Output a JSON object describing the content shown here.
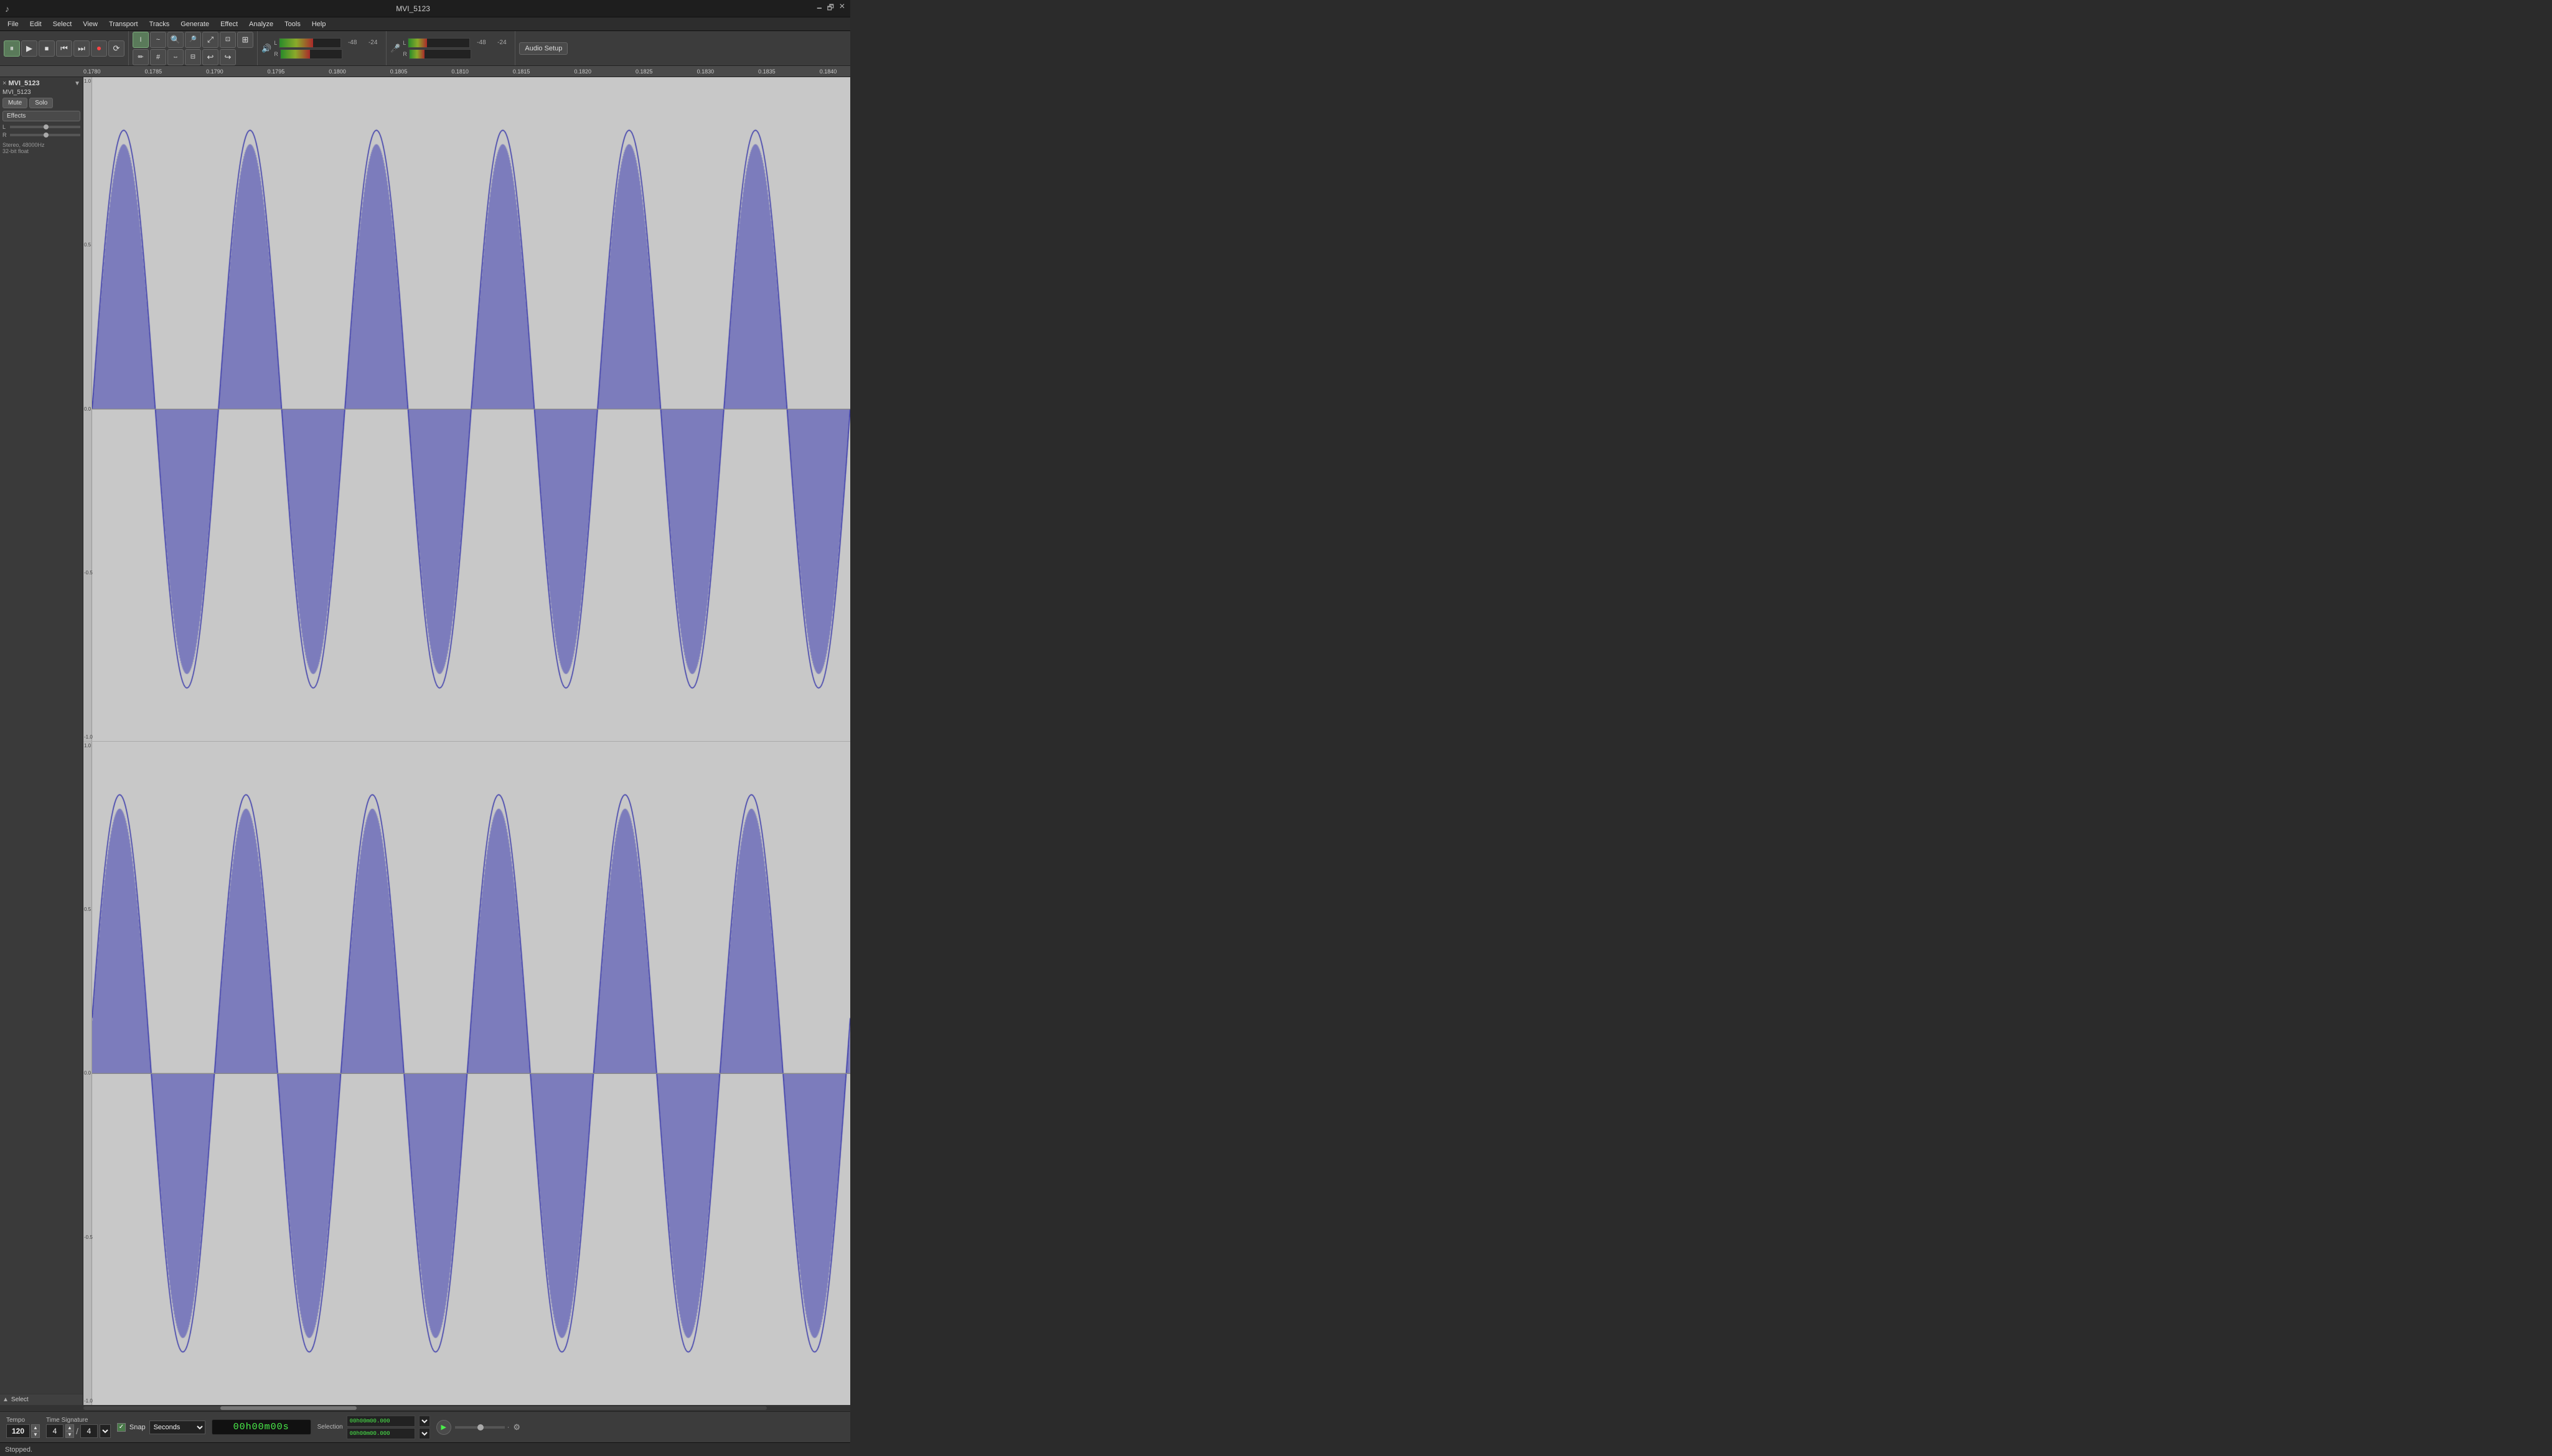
{
  "titlebar": {
    "logo": "♪",
    "title": "MVI_5123",
    "minimize": "🗕",
    "restore": "🗗",
    "close": "✕"
  },
  "menubar": {
    "items": [
      "File",
      "Edit",
      "Select",
      "View",
      "Transport",
      "Tracks",
      "Generate",
      "Effect",
      "Analyze",
      "Tools",
      "Help"
    ]
  },
  "toolbar": {
    "transport": {
      "pause_label": "⏸",
      "play_label": "▶",
      "stop_label": "⏹",
      "prev_label": "⏮",
      "next_label": "⏭",
      "record_label": "⏺",
      "loop_label": "⟳"
    },
    "tools": {
      "cursor_label": "I",
      "envelope_label": "~",
      "zoom_in_label": "+",
      "zoom_out_label": "−",
      "zoom_fit_label": "⤢",
      "zoom_sel_label": "⊡",
      "draw_label": "✏",
      "multi_label": "#",
      "time_shift": "⇔",
      "undo_label": "↩",
      "redo_label": "↪"
    },
    "audio_setup_label": "Audio Setup",
    "output_label": "-48",
    "output_label2": "-24",
    "input_label": "-48",
    "input_label2": "-24",
    "lr_output": "L R",
    "lr_input": "L R"
  },
  "ruler": {
    "ticks": [
      "0.1780",
      "0.1785",
      "0.1790",
      "0.1795",
      "0.1800",
      "0.1805",
      "0.1810",
      "0.1815",
      "0.1820",
      "0.1825",
      "0.1830",
      "0.1835",
      "0.1840"
    ]
  },
  "track": {
    "name": "MVI_5123",
    "close_label": "×",
    "arrow_label": "▼",
    "mute_label": "Mute",
    "solo_label": "Solo",
    "effects_label": "Effects",
    "header_name": "MVI_5123",
    "info_line1": "Stereo, 48000Hz",
    "info_line2": "32-bit float",
    "gain_label": "L",
    "scale_top": "1.0",
    "scale_mid_upper": "0.5",
    "scale_center": "0.0",
    "scale_mid_lower": "-0.5",
    "scale_bottom": "-1.0",
    "scale_top2": "1.0",
    "scale_mid_upper2": "0.5",
    "scale_center2": "0.0",
    "scale_mid_lower2": "-0.5",
    "scale_bottom2": "-1.0"
  },
  "bottom": {
    "tempo_label": "Tempo",
    "tempo_value": "120",
    "time_sig_label": "Time Signature",
    "time_sig_num": "4",
    "time_sig_denom": "4",
    "snap_label": "Snap",
    "snap_checked": true,
    "snap_unit": "Seconds",
    "time_display": "0 0 h 0 0 m 0 0 s",
    "selection_label": "Selection",
    "sel_start": "0 0 h 0 0 m 0 0 . 0 0 0",
    "sel_end": "0 0 h 0 0 m 0 0 . 0 0 0",
    "sel_icon": "⚙",
    "play_btn": "▶"
  },
  "statusbar": {
    "text": "Stopped."
  }
}
